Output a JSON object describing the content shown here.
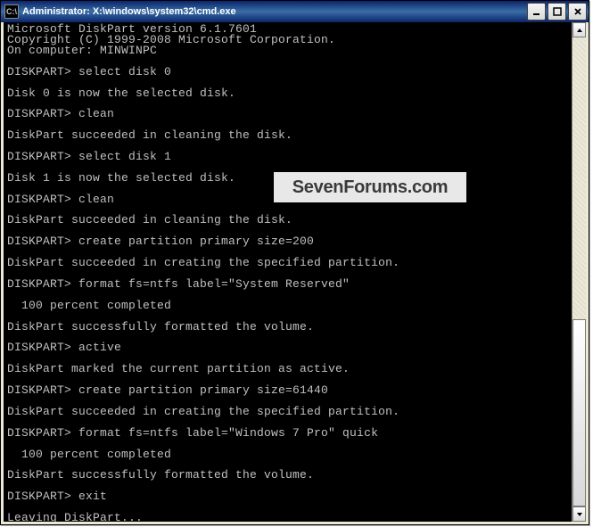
{
  "window": {
    "icon_glyph": "C:\\",
    "title": "Administrator: X:\\windows\\system32\\cmd.exe"
  },
  "terminal": {
    "lines": [
      "Microsoft DiskPart version 6.1.7601",
      "Copyright (C) 1999-2008 Microsoft Corporation.",
      "On computer: MINWINPC",
      "",
      "DISKPART> select disk 0",
      "",
      "Disk 0 is now the selected disk.",
      "",
      "DISKPART> clean",
      "",
      "DiskPart succeeded in cleaning the disk.",
      "",
      "DISKPART> select disk 1",
      "",
      "Disk 1 is now the selected disk.",
      "",
      "DISKPART> clean",
      "",
      "DiskPart succeeded in cleaning the disk.",
      "",
      "DISKPART> create partition primary size=200",
      "",
      "DiskPart succeeded in creating the specified partition.",
      "",
      "DISKPART> format fs=ntfs label=\"System Reserved\"",
      "",
      "  100 percent completed",
      "",
      "DiskPart successfully formatted the volume.",
      "",
      "DISKPART> active",
      "",
      "DiskPart marked the current partition as active.",
      "",
      "DISKPART> create partition primary size=61440",
      "",
      "DiskPart succeeded in creating the specified partition.",
      "",
      "DISKPART> format fs=ntfs label=\"Windows 7 Pro\" quick",
      "",
      "  100 percent completed",
      "",
      "DiskPart successfully formatted the volume.",
      "",
      "DISKPART> exit",
      "",
      "Leaving DiskPart..."
    ]
  },
  "watermark": "SevenForums.com"
}
